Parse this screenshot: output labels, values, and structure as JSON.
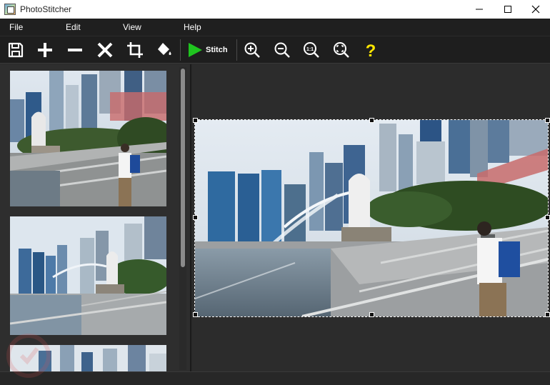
{
  "window": {
    "title": "PhotoStitcher"
  },
  "menu": {
    "items": [
      {
        "label": "File"
      },
      {
        "label": "Edit"
      },
      {
        "label": "View"
      },
      {
        "label": "Help"
      }
    ]
  },
  "toolbar": {
    "buttons": [
      {
        "icon": "save-icon"
      },
      {
        "icon": "plus-icon"
      },
      {
        "icon": "minus-icon"
      },
      {
        "icon": "delete-x-icon"
      },
      {
        "icon": "crop-icon"
      },
      {
        "icon": "paint-bucket-icon"
      },
      {
        "icon": "play-icon",
        "label": "Stitch"
      },
      {
        "icon": "zoom-in-icon"
      },
      {
        "icon": "zoom-out-icon"
      },
      {
        "icon": "zoom-actual-icon",
        "label": "1:1"
      },
      {
        "icon": "zoom-fit-icon"
      },
      {
        "icon": "help-icon",
        "label": "?"
      }
    ],
    "stitch_label": "Stitch",
    "actual_size_label": "1:1",
    "help_label": "?"
  },
  "thumbnails": [
    {
      "name": "photo-1"
    },
    {
      "name": "photo-2"
    },
    {
      "name": "photo-3"
    }
  ],
  "colors": {
    "background": "#2b2b2b",
    "toolbar": "#1e1e1e",
    "stitch_green": "#1fc41f",
    "help_yellow": "#ffe600"
  }
}
